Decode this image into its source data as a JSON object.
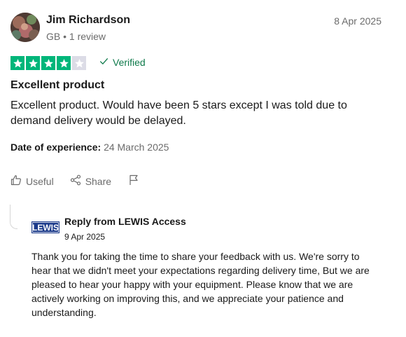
{
  "reviewer": {
    "name": "Jim Richardson",
    "meta": "GB • 1 review",
    "avatar": "profile-photo"
  },
  "review": {
    "date": "8 Apr 2025",
    "rating": 4,
    "max_rating": 5,
    "verified_label": "Verified",
    "title": "Excellent product",
    "body": "Excellent product. Would have been 5 stars except I was told due to demand delivery would be delayed.",
    "experience_label": "Date of experience:",
    "experience_date": "24 March 2025"
  },
  "actions": {
    "useful_label": "Useful",
    "share_label": "Share",
    "report_icon": "flag-icon"
  },
  "reply": {
    "company_logo_text": "LEWIS",
    "from_label": "Reply from LEWIS Access",
    "date": "9 Apr 2025",
    "body": "Thank you for taking the time to share your feedback with us. We're sorry to hear that we didn't meet your expectations regarding delivery time, But we are pleased to hear your happy with your equipment. Please know that we are actively working on improving this, and we appreciate your patience and understanding."
  },
  "colors": {
    "star_green": "#00b67a",
    "star_empty": "#dcdce6",
    "verified_green": "#0f7a4b",
    "muted_text": "#6b6b6b",
    "logo_blue": "#1b3a8a"
  }
}
